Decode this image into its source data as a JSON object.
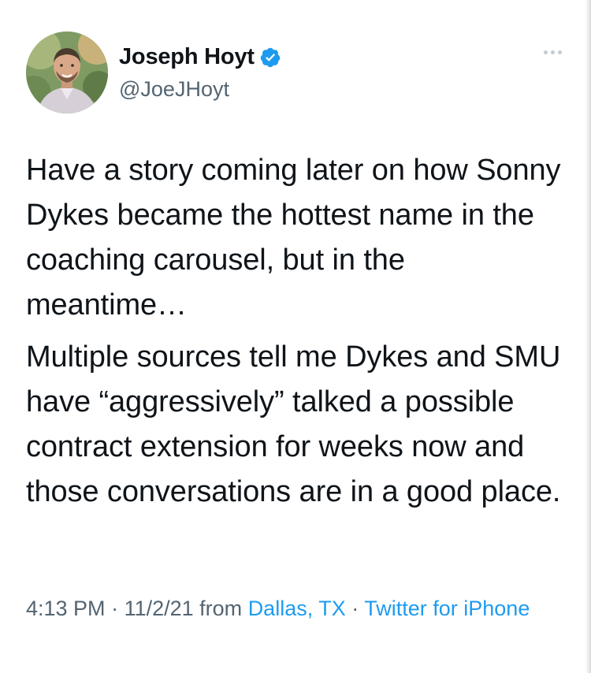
{
  "author": {
    "display_name": "Joseph Hoyt",
    "handle": "@JoeJHoyt",
    "verified": true,
    "avatar_icon": "profile-photo"
  },
  "more_icon": "more-horizontal-icon",
  "tweet": {
    "paragraphs": [
      "Have a story coming later on how Sonny Dykes became the hottest name in the coaching carousel, but in the meantime…",
      "Multiple sources tell me Dykes and SMU have “aggressively” talked a possible contract extension for weeks now and those conversations are in a good place."
    ]
  },
  "meta": {
    "time": "4:13 PM",
    "separator": " · ",
    "date": "11/2/21",
    "from_label": "from",
    "location": "Dallas, TX",
    "source": "Twitter for iPhone"
  },
  "colors": {
    "text": "#0f1419",
    "secondary": "#536471",
    "link": "#1d9bf0",
    "verified": "#1d9bf0"
  }
}
